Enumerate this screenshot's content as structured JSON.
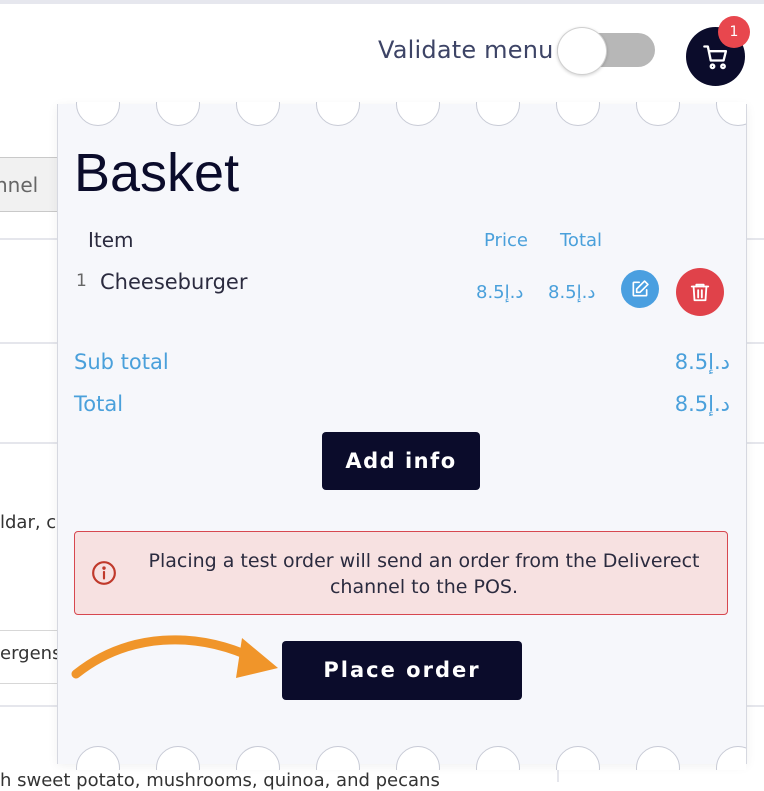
{
  "background": {
    "channel_select_text": "nnel",
    "description_fragment": "ldar, ca",
    "allergens_fragment": "ergens",
    "bottom_description": "h sweet potato, mushrooms, quinoa, and pecans"
  },
  "header": {
    "validate_label": "Validate menu",
    "validate_toggle_on": false,
    "cart_icon": "cart-icon",
    "cart_badge_count": "1"
  },
  "basket": {
    "title": "Basket",
    "columns": {
      "item": "Item",
      "price": "Price",
      "total": "Total"
    },
    "items": [
      {
        "qty": "1",
        "name": "Cheeseburger",
        "price": "8.5د.إ",
        "total": "8.5د.إ"
      }
    ],
    "sub_total_label": "Sub total",
    "sub_total_value": "8.5د.إ",
    "total_label": "Total",
    "total_value": "8.5د.إ",
    "add_info_label": "Add info",
    "alert_text": "Placing a test order will send an order from the Deliverect channel to the POS.",
    "place_order_label": "Place order"
  },
  "colors": {
    "primary_dark": "#0b0c2b",
    "accent_blue": "#4aa0db",
    "danger_red": "#e0424a",
    "badge_red": "#e8474e",
    "arrow_orange": "#f0952a"
  }
}
